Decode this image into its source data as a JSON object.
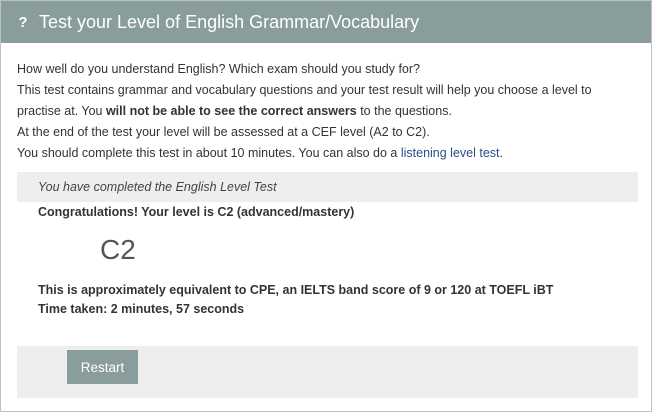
{
  "header": {
    "icon": "?",
    "title": "Test your Level of English Grammar/Vocabulary"
  },
  "intro": {
    "line1": "How well do you understand English? Which exam should you study for?",
    "line2": "This test contains grammar and vocabulary questions and your test result will help you choose a level to",
    "line3_pre": "practise at. You ",
    "line3_bold": "will not be able to see the correct answers",
    "line3_post": " to the questions.",
    "line4": "At the end of the test your level will be assessed at a CEF level (A2 to C2).",
    "line5_pre": "You should complete this test in about 10 minutes. You can also do a ",
    "line5_link": "listening level test",
    "line5_post": "."
  },
  "result": {
    "completed_message": "You have completed the English Level Test",
    "congrats": "Congratulations! Your level is C2 (advanced/mastery)",
    "level": "C2",
    "equivalent": "This is approximately equivalent to CPE, an IELTS band score of 9 or 120 at TOEFL iBT",
    "time_taken": "Time taken: 2 minutes, 57 seconds"
  },
  "actions": {
    "restart_label": "Restart"
  },
  "colors": {
    "header_bg": "#889d9c",
    "link": "#2b4f8a",
    "bar_bg": "#eeeeee"
  }
}
